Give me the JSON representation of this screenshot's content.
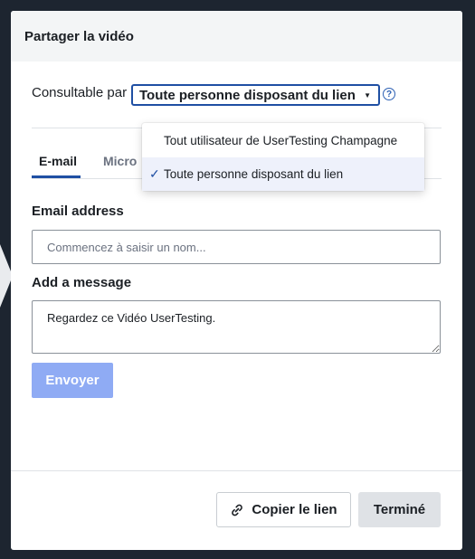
{
  "modal": {
    "title": "Partager la vidéo"
  },
  "visibility": {
    "label": "Consultable par",
    "selected": "Toute personne disposant du lien",
    "options": [
      "Tout utilisateur de UserTesting Champagne",
      "Toute personne disposant du lien"
    ],
    "selected_index": 1
  },
  "tabs": [
    "E-mail",
    "Micro"
  ],
  "email": {
    "label": "Email address",
    "placeholder": "Commencez à saisir un nom..."
  },
  "message": {
    "label": "Add a message",
    "value": "Regardez ce Vidéo UserTesting."
  },
  "buttons": {
    "send": "Envoyer",
    "copy_link": "Copier le lien",
    "done": "Terminé"
  },
  "colors": {
    "accent": "#1f4fa3",
    "send_disabled": "#8fabf4",
    "selected_option_bg": "#eef1fb"
  }
}
